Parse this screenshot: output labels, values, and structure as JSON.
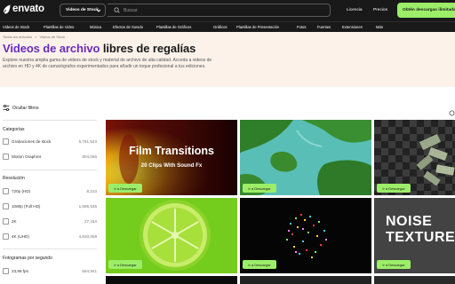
{
  "topbar": {
    "logo_text": "envato",
    "category_select": "Videos de Stock",
    "search_placeholder": "Buscar",
    "links": [
      "Licencia",
      "Precios"
    ],
    "cta": "Obtén descargas ilimitadas"
  },
  "category_nav": [
    "Videos de Stock",
    "Plantillas de Video",
    "Música",
    "Efectos de Sonido",
    "Plantillas de Gráficos",
    "Gráficos",
    "Plantillas de Presentación",
    "Fotos",
    "Fuentes",
    "Extensiones",
    "Más"
  ],
  "breadcrumb": [
    "Todos los artículos",
    "Videos de Stock"
  ],
  "hero": {
    "title_accent": "Videos de archivo",
    "title_rest": " libres de regalías",
    "description": "Explore nuestra amplia gama de videos de stock y material de archivo de alta calidad. Acceda a videos de archivo en HD y 4K de camarógrafos experimentados para añadir un toque profesional a tus ediciones."
  },
  "filters": {
    "toggle_label": "Ocultar filtros",
    "groups": [
      {
        "title": "Categorías",
        "options": [
          {
            "label": "Grabaciones de stock",
            "count": "5,761,523"
          },
          {
            "label": "Motion Graphics",
            "count": "804,066"
          }
        ]
      },
      {
        "title": "Resolución",
        "options": [
          {
            "label": "720p (HD)",
            "count": "8,210"
          },
          {
            "label": "1080p (Full HD)",
            "count": "1,695,535"
          },
          {
            "label": "2K",
            "count": "27,434"
          },
          {
            "label": "4K (UHD)",
            "count": "4,833,069"
          }
        ]
      },
      {
        "title": "Fotogramas por segundo",
        "options": [
          {
            "label": "23,98 fps",
            "count": "584,941"
          }
        ]
      }
    ]
  },
  "results": {
    "download_label": "Ir a Descargar",
    "tiles": [
      {
        "overlay_title": "Film Transitions",
        "overlay_sub": "20 Clips With Sound Fx"
      },
      {
        "overlay_title": ""
      },
      {
        "overlay_title": ""
      },
      {
        "overlay_title": ""
      },
      {
        "overlay_title": ""
      },
      {
        "overlay_title": "NOISE TEXTURE"
      }
    ]
  },
  "colors": {
    "accent_green": "#9cee69",
    "title_purple": "#6a2cbd",
    "hero_bg": "#fcf2ea",
    "topbar_bg": "#191919"
  }
}
